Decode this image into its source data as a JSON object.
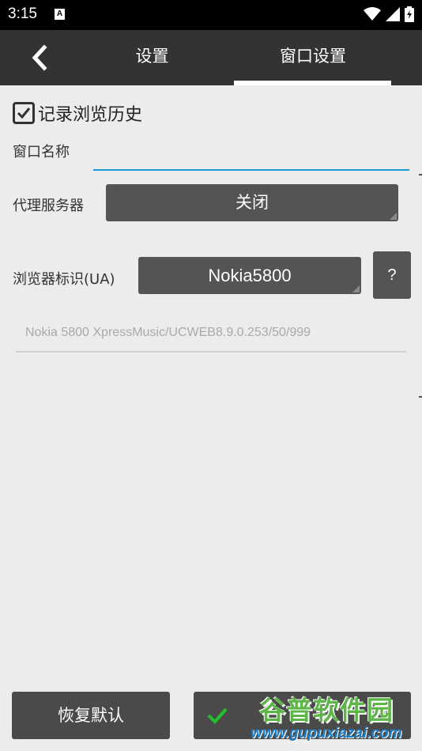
{
  "status_bar": {
    "time": "3:15",
    "notification_letter": "A",
    "icons": [
      "wifi-icon",
      "signal-icon",
      "battery-charging-icon"
    ]
  },
  "header": {
    "back_icon": "chevron-left-icon",
    "tabs": [
      {
        "label": "设置",
        "selected": false
      },
      {
        "label": "窗口设置",
        "selected": true
      }
    ]
  },
  "form": {
    "record_history": {
      "label": "记录浏览历史",
      "checked": true
    },
    "window_name": {
      "label": "窗口名称",
      "value": ""
    },
    "proxy": {
      "label": "代理服务器",
      "value": "关闭"
    },
    "user_agent": {
      "label": "浏览器标识(UA)",
      "value": "Nokia5800",
      "help_label": "?",
      "ua_string": "Nokia 5800 XpressMusic/UCWEB8.9.0.253/50/999"
    }
  },
  "footer": {
    "restore_label": "恢复默认",
    "ok_icon": "check-icon"
  },
  "watermark": {
    "title": "谷普软件园",
    "url": "www.gupuxiazai.com"
  },
  "colors": {
    "background": "#ececec",
    "header": "#333333",
    "button": "#545454",
    "accent": "#1a9ad6",
    "check_green": "#22c02a"
  }
}
